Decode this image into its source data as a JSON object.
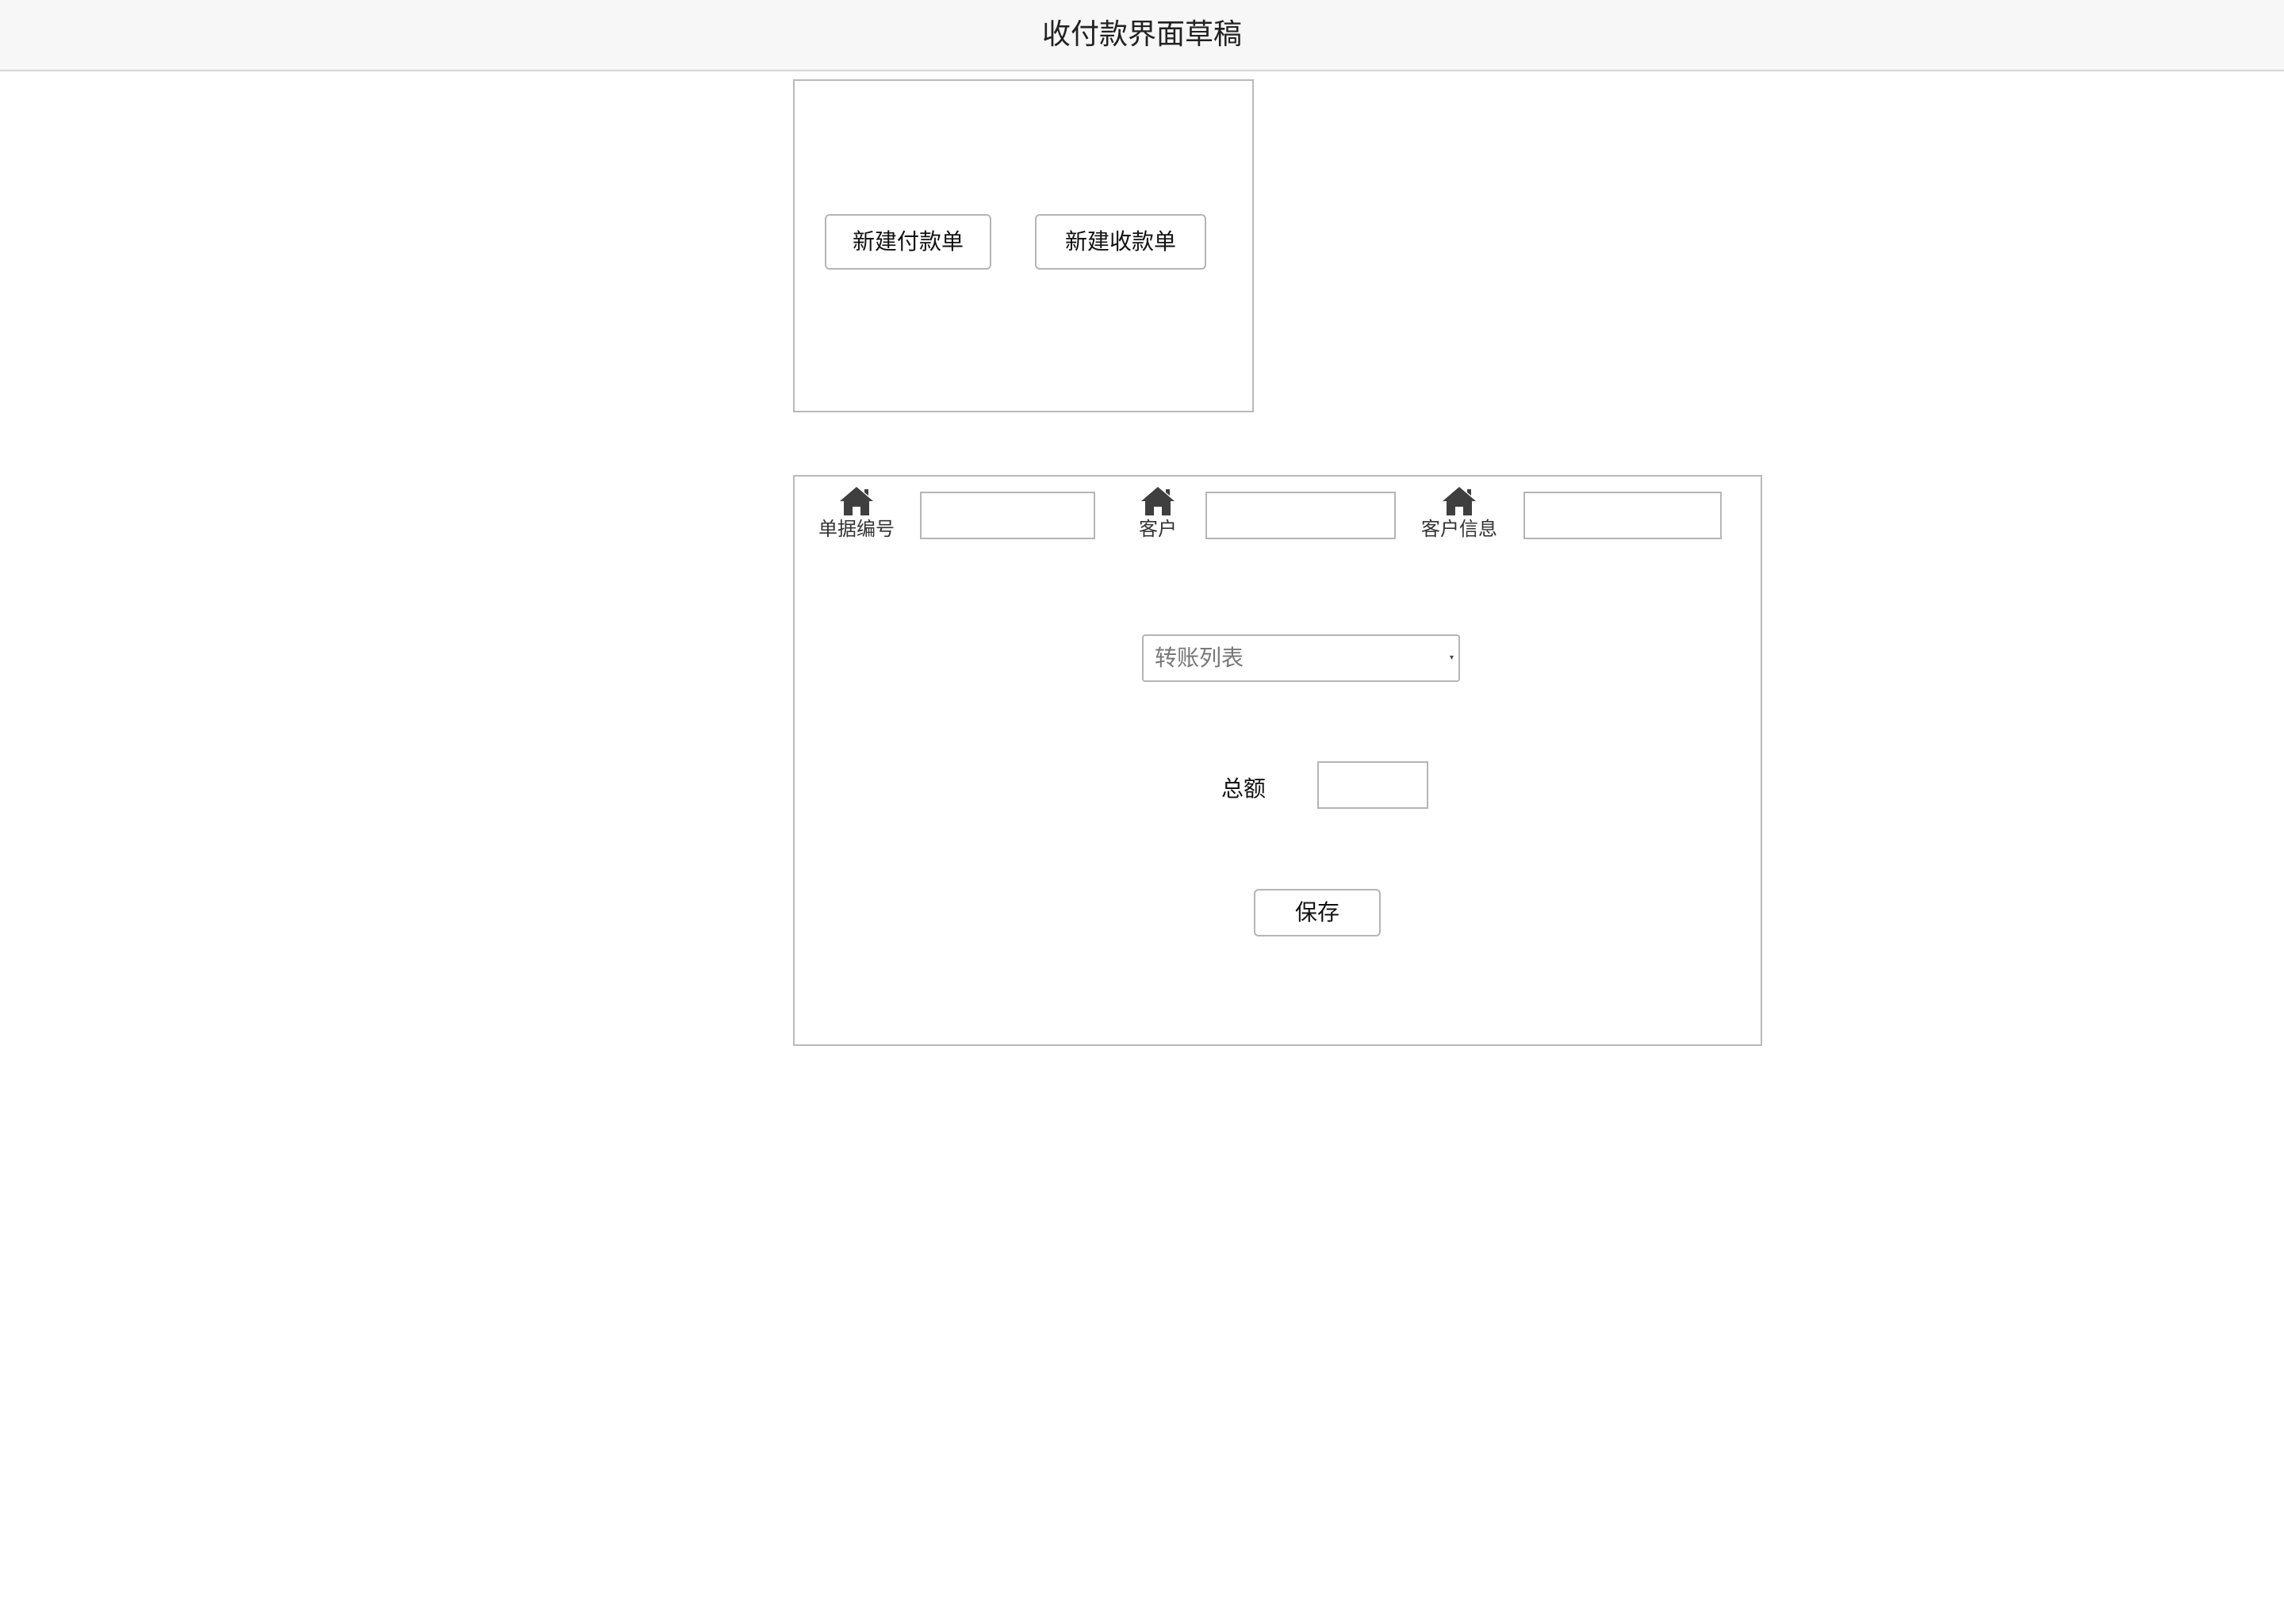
{
  "header": {
    "title": "收付款界面草稿"
  },
  "new_panel": {
    "new_payment_button": "新建付款单",
    "new_receipt_button": "新建收款单"
  },
  "form": {
    "fields": [
      {
        "label": "单据编号",
        "icon": "home-icon",
        "value": ""
      },
      {
        "label": "客户",
        "icon": "home-icon",
        "value": ""
      },
      {
        "label": "客户信息",
        "icon": "home-icon",
        "value": ""
      }
    ],
    "transfer_select": {
      "selected": "转账列表",
      "arrow": "▾"
    },
    "total": {
      "label": "总额",
      "value": ""
    },
    "save_button": "保存"
  },
  "colors": {
    "header_bg": "#f7f7f7",
    "border": "#b5b5b5",
    "icon": "#3f3f3f"
  }
}
